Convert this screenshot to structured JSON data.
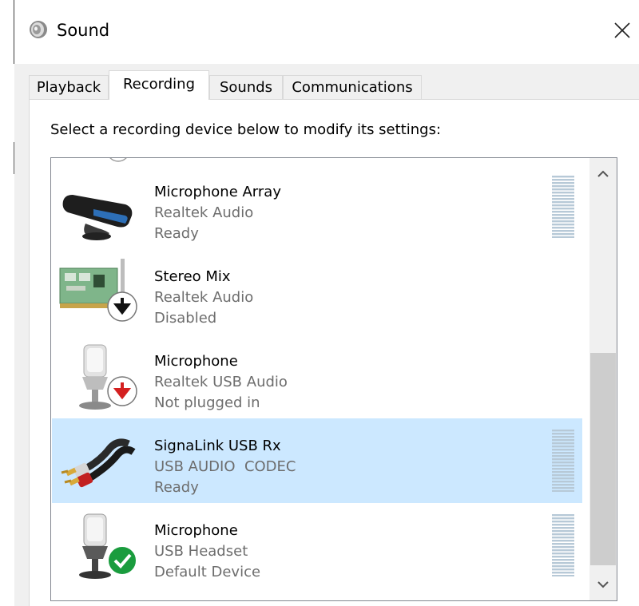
{
  "window": {
    "title": "Sound"
  },
  "tabs": [
    {
      "label": "Playback"
    },
    {
      "label": "Recording"
    },
    {
      "label": "Sounds"
    },
    {
      "label": "Communications"
    }
  ],
  "active_tab": "Recording",
  "instructions": "Select a recording device below to modify its settings:",
  "devices": [
    {
      "name": "Microphone Array",
      "driver": "Realtek Audio",
      "status": "Ready",
      "icon": "webcam-mic-icon",
      "selected": false
    },
    {
      "name": "Stereo Mix",
      "driver": "Realtek Audio",
      "status": "Disabled",
      "icon": "sound-card-icon",
      "badge": "disabled-badge-icon",
      "selected": false
    },
    {
      "name": "Microphone",
      "driver": "Realtek USB Audio",
      "status": "Not plugged in",
      "icon": "microphone-icon",
      "badge": "unplugged-badge-icon",
      "selected": false
    },
    {
      "name": "SignaLink USB Rx",
      "driver": "USB AUDIO  CODEC",
      "status": "Ready",
      "icon": "rca-cable-icon",
      "selected": true
    },
    {
      "name": "Microphone",
      "driver": "USB Headset",
      "status": "Default Device",
      "icon": "microphone-icon",
      "badge": "default-check-badge-icon",
      "selected": false
    }
  ],
  "colors": {
    "selection": "#cce8ff",
    "panel_bg": "#f0f0f0",
    "secondary_text": "#6d6d6d",
    "meter": "#b7c9d7",
    "check_badge": "#1a9c3e",
    "unplugged_arrow": "#d42020"
  }
}
